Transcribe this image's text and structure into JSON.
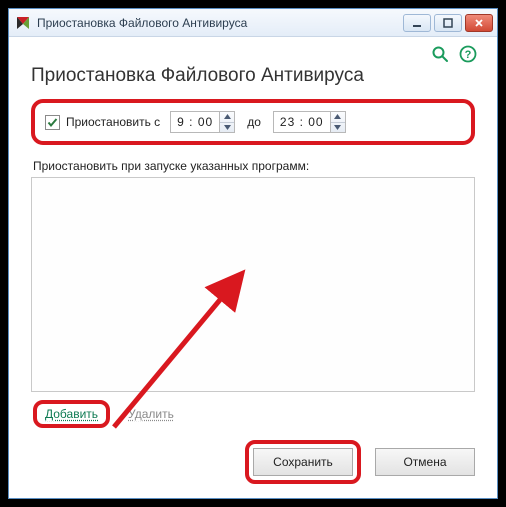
{
  "titlebar": {
    "title": "Приостановка Файлового Антивируса"
  },
  "heading": "Приостановка Файлового Антивируса",
  "pause_row": {
    "checkbox_checked": true,
    "label": "Приостановить с",
    "from_time": "9 : 00",
    "separator": "до",
    "to_time": "23 : 00"
  },
  "programs": {
    "label": "Приостановить при запуске указанных программ:"
  },
  "links": {
    "add": "Добавить",
    "delete": "Удалить"
  },
  "buttons": {
    "save": "Сохранить",
    "cancel": "Отмена"
  },
  "colors": {
    "highlight": "#d9181f",
    "link_green": "#0d7a52"
  }
}
